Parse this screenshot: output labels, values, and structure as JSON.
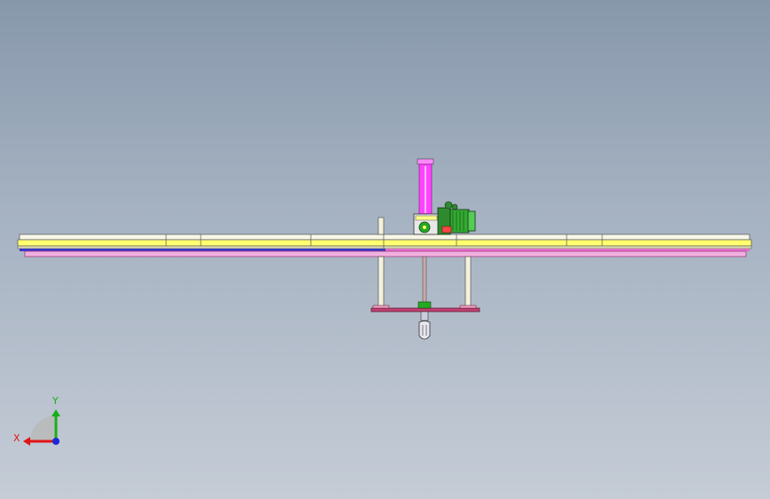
{
  "viewport": {
    "background_top": "#8798ab",
    "background_bottom": "#c5ccd6"
  },
  "triad": {
    "x_label": "X",
    "y_label": "Y",
    "x_color": "#e01515",
    "y_color": "#17b017",
    "z_color": "#1a2ad8"
  },
  "colors": {
    "rail_top": "#f5f5c0",
    "rail_mid": "#ffff66",
    "rail_blue": "#3a3ac8",
    "rail_pink": "#e060c0",
    "cylinder": "#ff44ff",
    "motor": "#22aa22",
    "plate": "#b03060",
    "post": "#f2f0d8"
  }
}
